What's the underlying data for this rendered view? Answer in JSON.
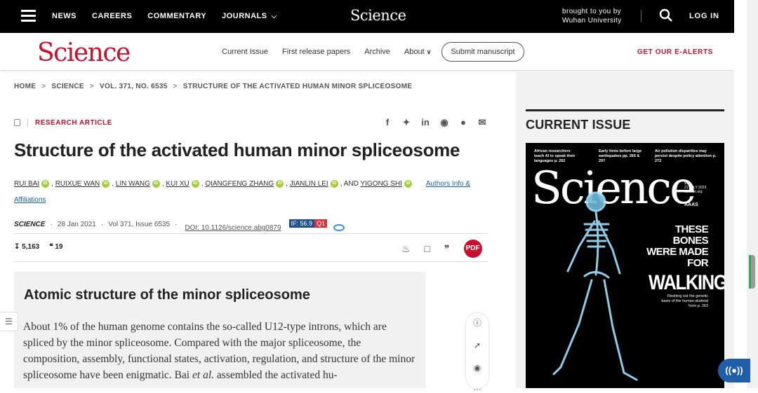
{
  "topbar": {
    "nav": [
      "NEWS",
      "CAREERS",
      "COMMENTARY",
      "JOURNALS"
    ],
    "logo": "Science",
    "brought_line1": "brought to you by",
    "brought_line2": "Wuhan University",
    "login": "LOG IN"
  },
  "subbar": {
    "brand": "Science",
    "links": [
      "Current Issue",
      "First release papers",
      "Archive",
      "About"
    ],
    "submit": "Submit manuscript",
    "alerts": "GET OUR E-ALERTS"
  },
  "breadcrumb": [
    "HOME",
    "SCIENCE",
    "VOL. 371, NO. 6535",
    "STRUCTURE OF THE ACTIVATED HUMAN MINOR SPLICEOSOME"
  ],
  "article": {
    "type": "RESEARCH ARTICLE",
    "title": "Structure of the activated human minor spliceosome",
    "authors": [
      "RUI BAI",
      "RUIXUE WAN",
      "LIN WANG",
      "KUI XU",
      "QIANGFENG ZHANG",
      "JIANLIN LEI",
      "YIGONG SHI"
    ],
    "and": ", AND",
    "affiliations": "Authors Info &",
    "affiliations2": "Affiliations",
    "journal": "SCIENCE",
    "date": "28 Jan 2021",
    "issue": "Vol 371, Issue 6535",
    "doi": "DOI: 10.1126/science.abg0879",
    "if": "IF: 56.9",
    "quartile": "Q1",
    "downloads": "5,163",
    "citations": "19"
  },
  "abstract": {
    "heading": "Atomic structure of the minor spliceosome",
    "text_a": "About 1% of the human genome contains the so-called U12-type introns, which are spliced by the minor spliceosome. Compared with the major spliceosome, the composition, assembly, functional states, activation, regulation, and structure of the minor spliceosome have been enigmatic. Bai ",
    "text_em": "et al.",
    "text_b": " assembled the activated hu-"
  },
  "sidebar": {
    "heading": "CURRENT ISSUE",
    "cover": {
      "headline1": "African researchers teach AI to speak their languages",
      "headline1_page": "p. 262",
      "headline2": "Early hints before large earthquakes",
      "headline2_page": "pp. 266 & 297",
      "headline3": "Air pollution disparities may persist despite policy attention",
      "headline3_page": "p. 272",
      "masthead": "Science",
      "price": "$15",
      "issue_date": "21 JULY 2023",
      "site": "science.org",
      "publisher": "AAAS",
      "cover_line": "THESE BONES WERE MADE FOR",
      "cover_big": "WALKING",
      "caption": "Fleshing out the genetic basis of the human skeletal form",
      "caption_page": "p. 263"
    }
  }
}
